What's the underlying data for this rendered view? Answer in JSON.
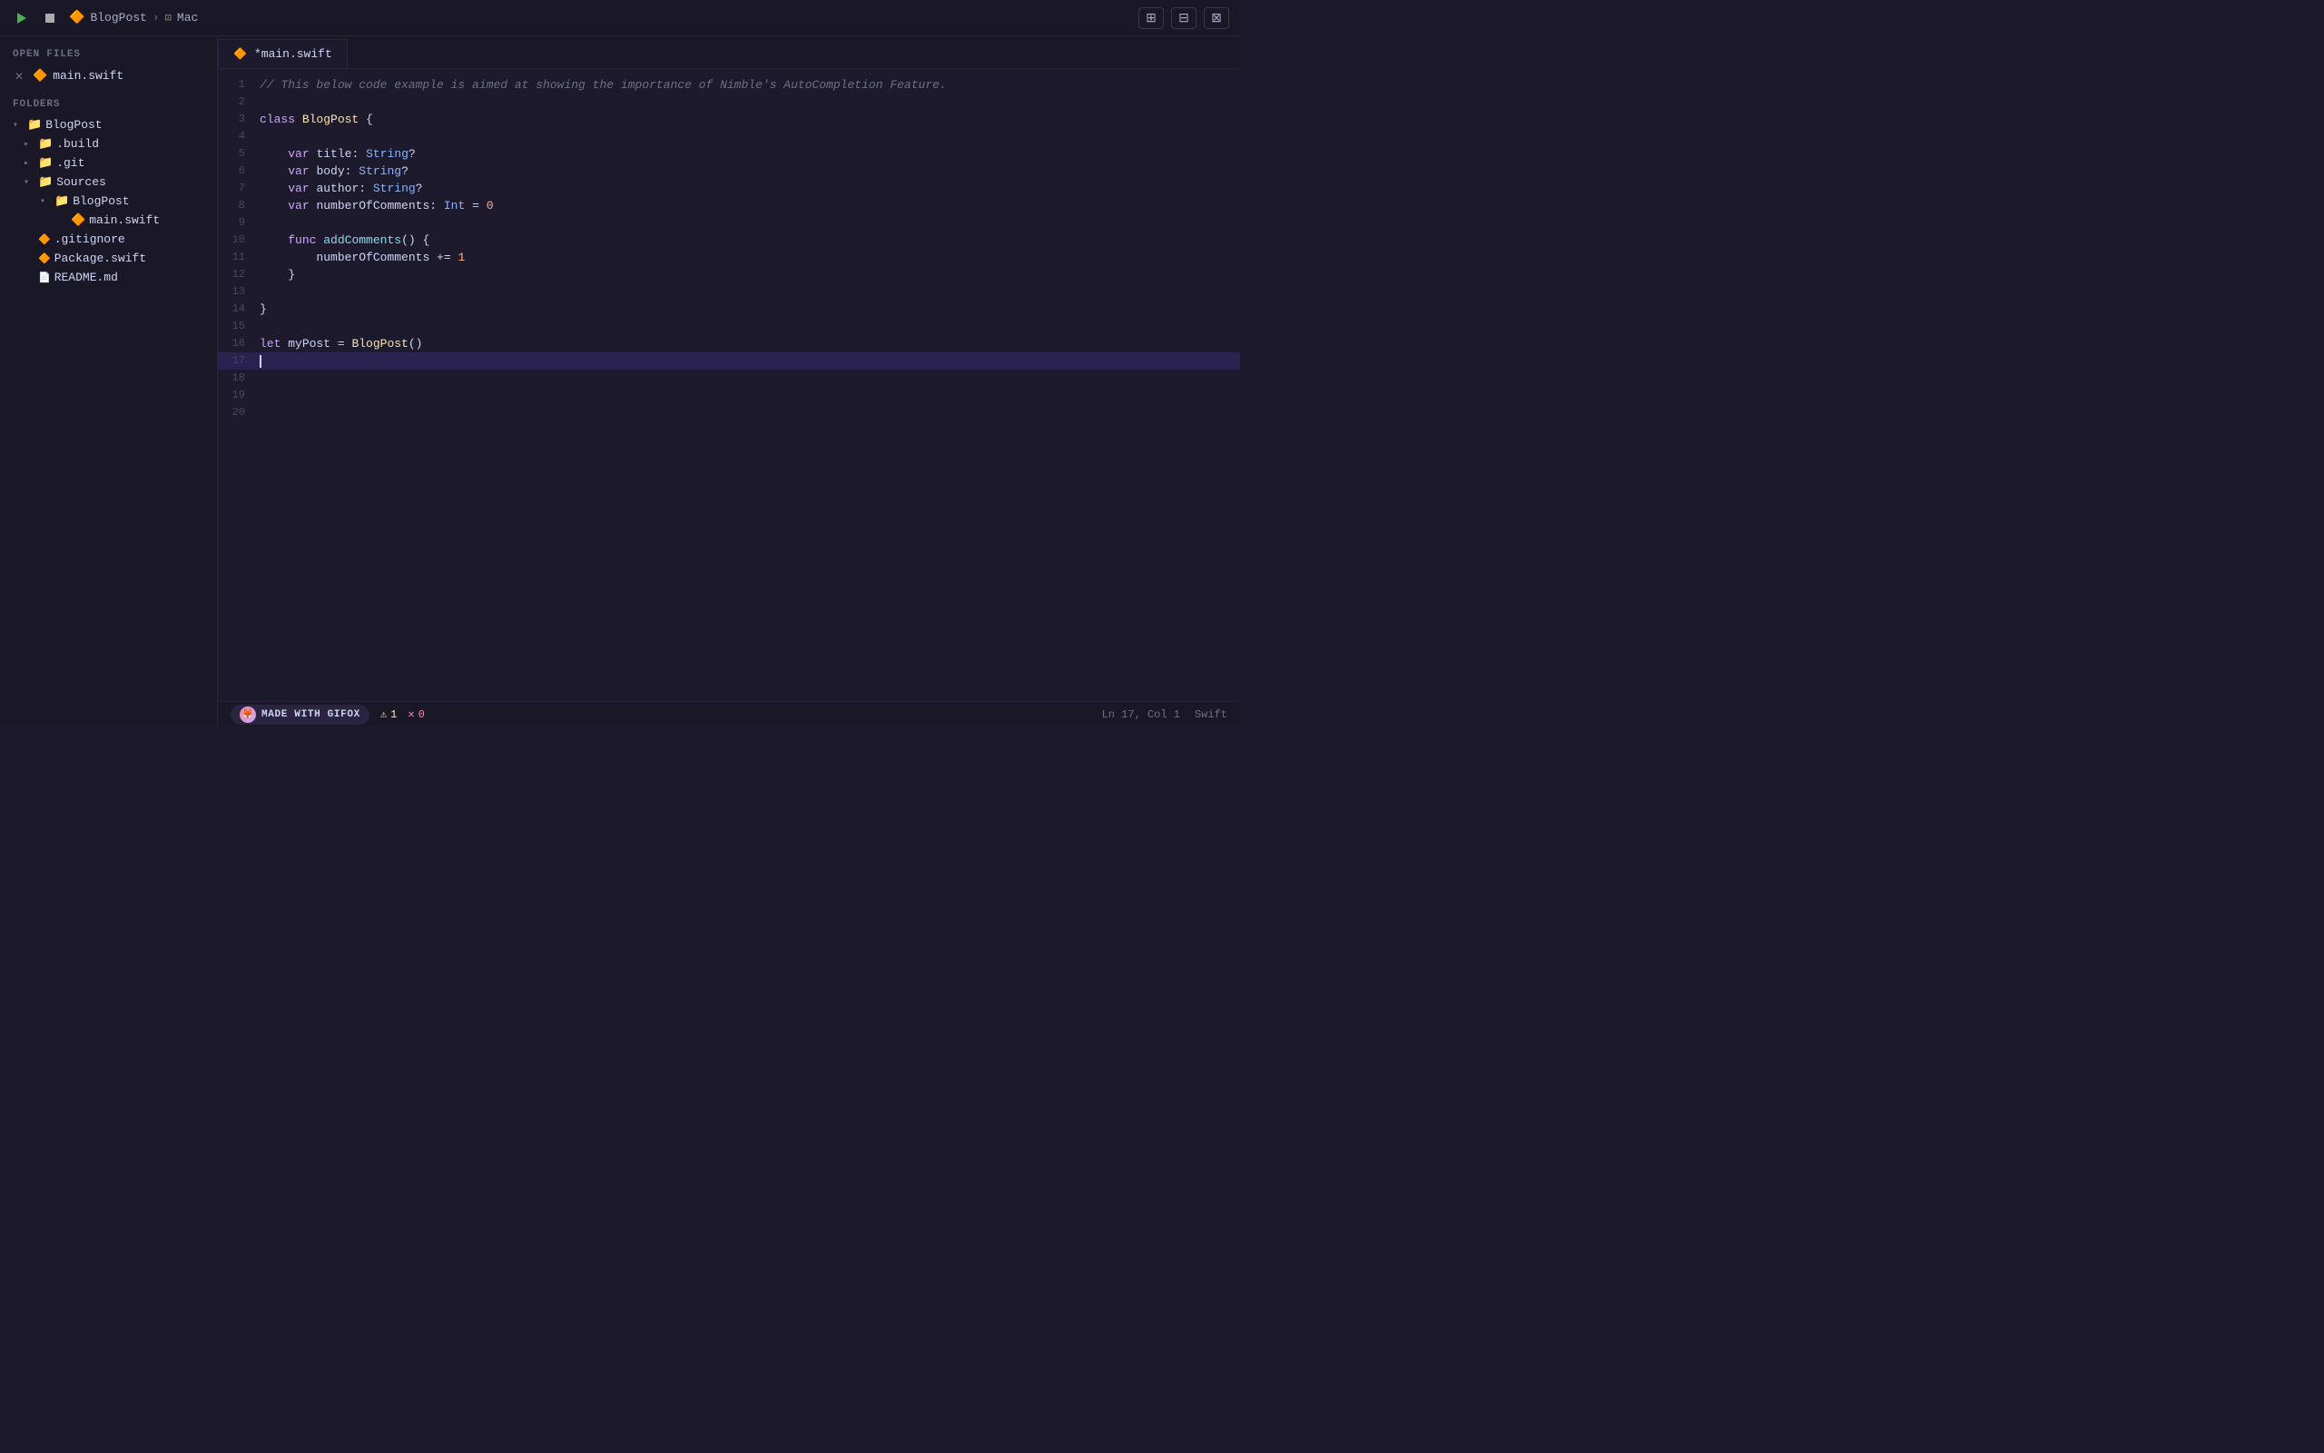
{
  "titlebar": {
    "play_label": "▶",
    "stop_label": "■",
    "breadcrumb": {
      "project": "BlogPost",
      "separator": "›",
      "target": "Mac"
    },
    "layout_btns": [
      "⊞",
      "⊟",
      "⊠"
    ]
  },
  "sidebar": {
    "open_files_label": "OPEN FILES",
    "folders_label": "FOLDERS",
    "open_files": [
      {
        "name": "main.swift",
        "icon": "swift"
      }
    ],
    "tree": [
      {
        "level": 0,
        "type": "folder",
        "name": "BlogPost",
        "open": true,
        "chevron": "▾"
      },
      {
        "level": 1,
        "type": "folder",
        "name": ".build",
        "open": false,
        "chevron": "▸"
      },
      {
        "level": 1,
        "type": "folder",
        "name": ".git",
        "open": false,
        "chevron": "▸"
      },
      {
        "level": 1,
        "type": "folder",
        "name": "Sources",
        "open": true,
        "chevron": "▾"
      },
      {
        "level": 2,
        "type": "folder",
        "name": "BlogPost",
        "open": true,
        "chevron": "▾"
      },
      {
        "level": 3,
        "type": "file",
        "name": "main.swift",
        "icon": "swift"
      },
      {
        "level": 1,
        "type": "file",
        "name": ".gitignore",
        "icon": "gitignore"
      },
      {
        "level": 1,
        "type": "file",
        "name": "Package.swift",
        "icon": "swift"
      },
      {
        "level": 1,
        "type": "file",
        "name": "README.md",
        "icon": "readme"
      }
    ]
  },
  "editor": {
    "tab": {
      "name": "*main.swift",
      "modified": true
    },
    "lines": [
      {
        "num": 1,
        "tokens": [
          {
            "t": "comment",
            "v": "// This below code example is aimed at showing the importance of Nimble's AutoCompletion Feature."
          }
        ]
      },
      {
        "num": 2,
        "tokens": []
      },
      {
        "num": 3,
        "tokens": [
          {
            "t": "kw",
            "v": "class"
          },
          {
            "t": "plain",
            "v": " "
          },
          {
            "t": "class-name",
            "v": "BlogPost"
          },
          {
            "t": "plain",
            "v": " {"
          }
        ]
      },
      {
        "num": 4,
        "tokens": []
      },
      {
        "num": 5,
        "tokens": [
          {
            "t": "plain",
            "v": "    "
          },
          {
            "t": "kw",
            "v": "var"
          },
          {
            "t": "plain",
            "v": " "
          },
          {
            "t": "var-name",
            "v": "title"
          },
          {
            "t": "plain",
            "v": ": "
          },
          {
            "t": "type",
            "v": "String"
          },
          {
            "t": "plain",
            "v": "?"
          }
        ]
      },
      {
        "num": 6,
        "tokens": [
          {
            "t": "plain",
            "v": "    "
          },
          {
            "t": "kw",
            "v": "var"
          },
          {
            "t": "plain",
            "v": " "
          },
          {
            "t": "var-name",
            "v": "body"
          },
          {
            "t": "plain",
            "v": ": "
          },
          {
            "t": "type",
            "v": "String"
          },
          {
            "t": "plain",
            "v": "?"
          }
        ]
      },
      {
        "num": 7,
        "tokens": [
          {
            "t": "plain",
            "v": "    "
          },
          {
            "t": "kw",
            "v": "var"
          },
          {
            "t": "plain",
            "v": " "
          },
          {
            "t": "var-name",
            "v": "author"
          },
          {
            "t": "plain",
            "v": ": "
          },
          {
            "t": "type",
            "v": "String"
          },
          {
            "t": "plain",
            "v": "?"
          }
        ]
      },
      {
        "num": 8,
        "tokens": [
          {
            "t": "plain",
            "v": "    "
          },
          {
            "t": "kw",
            "v": "var"
          },
          {
            "t": "plain",
            "v": " "
          },
          {
            "t": "var-name",
            "v": "numberOfComments"
          },
          {
            "t": "plain",
            "v": ": "
          },
          {
            "t": "type",
            "v": "Int"
          },
          {
            "t": "plain",
            "v": " = "
          },
          {
            "t": "num",
            "v": "0"
          }
        ]
      },
      {
        "num": 9,
        "tokens": []
      },
      {
        "num": 10,
        "tokens": [
          {
            "t": "plain",
            "v": "    "
          },
          {
            "t": "kw",
            "v": "func"
          },
          {
            "t": "plain",
            "v": " "
          },
          {
            "t": "func-name",
            "v": "addComments"
          },
          {
            "t": "plain",
            "v": "() {"
          }
        ]
      },
      {
        "num": 11,
        "tokens": [
          {
            "t": "plain",
            "v": "        "
          },
          {
            "t": "var-name",
            "v": "numberOfComments"
          },
          {
            "t": "plain",
            "v": " += "
          },
          {
            "t": "num",
            "v": "1"
          }
        ]
      },
      {
        "num": 12,
        "tokens": [
          {
            "t": "plain",
            "v": "    }"
          }
        ]
      },
      {
        "num": 13,
        "tokens": []
      },
      {
        "num": 14,
        "tokens": [
          {
            "t": "plain",
            "v": "}"
          }
        ]
      },
      {
        "num": 15,
        "tokens": []
      },
      {
        "num": 16,
        "tokens": [
          {
            "t": "kw",
            "v": "let"
          },
          {
            "t": "plain",
            "v": " "
          },
          {
            "t": "var-name",
            "v": "myPost"
          },
          {
            "t": "plain",
            "v": " = "
          },
          {
            "t": "class-name",
            "v": "BlogPost"
          },
          {
            "t": "plain",
            "v": "()"
          }
        ]
      },
      {
        "num": 17,
        "tokens": [],
        "active": true,
        "cursor": true
      },
      {
        "num": 18,
        "tokens": []
      },
      {
        "num": 19,
        "tokens": []
      },
      {
        "num": 20,
        "tokens": []
      }
    ]
  },
  "statusbar": {
    "gifox_label": "MADE WITH GIFOX",
    "warnings": "1",
    "errors": "0",
    "position": "Ln 17, Col 1",
    "language": "Swift"
  }
}
